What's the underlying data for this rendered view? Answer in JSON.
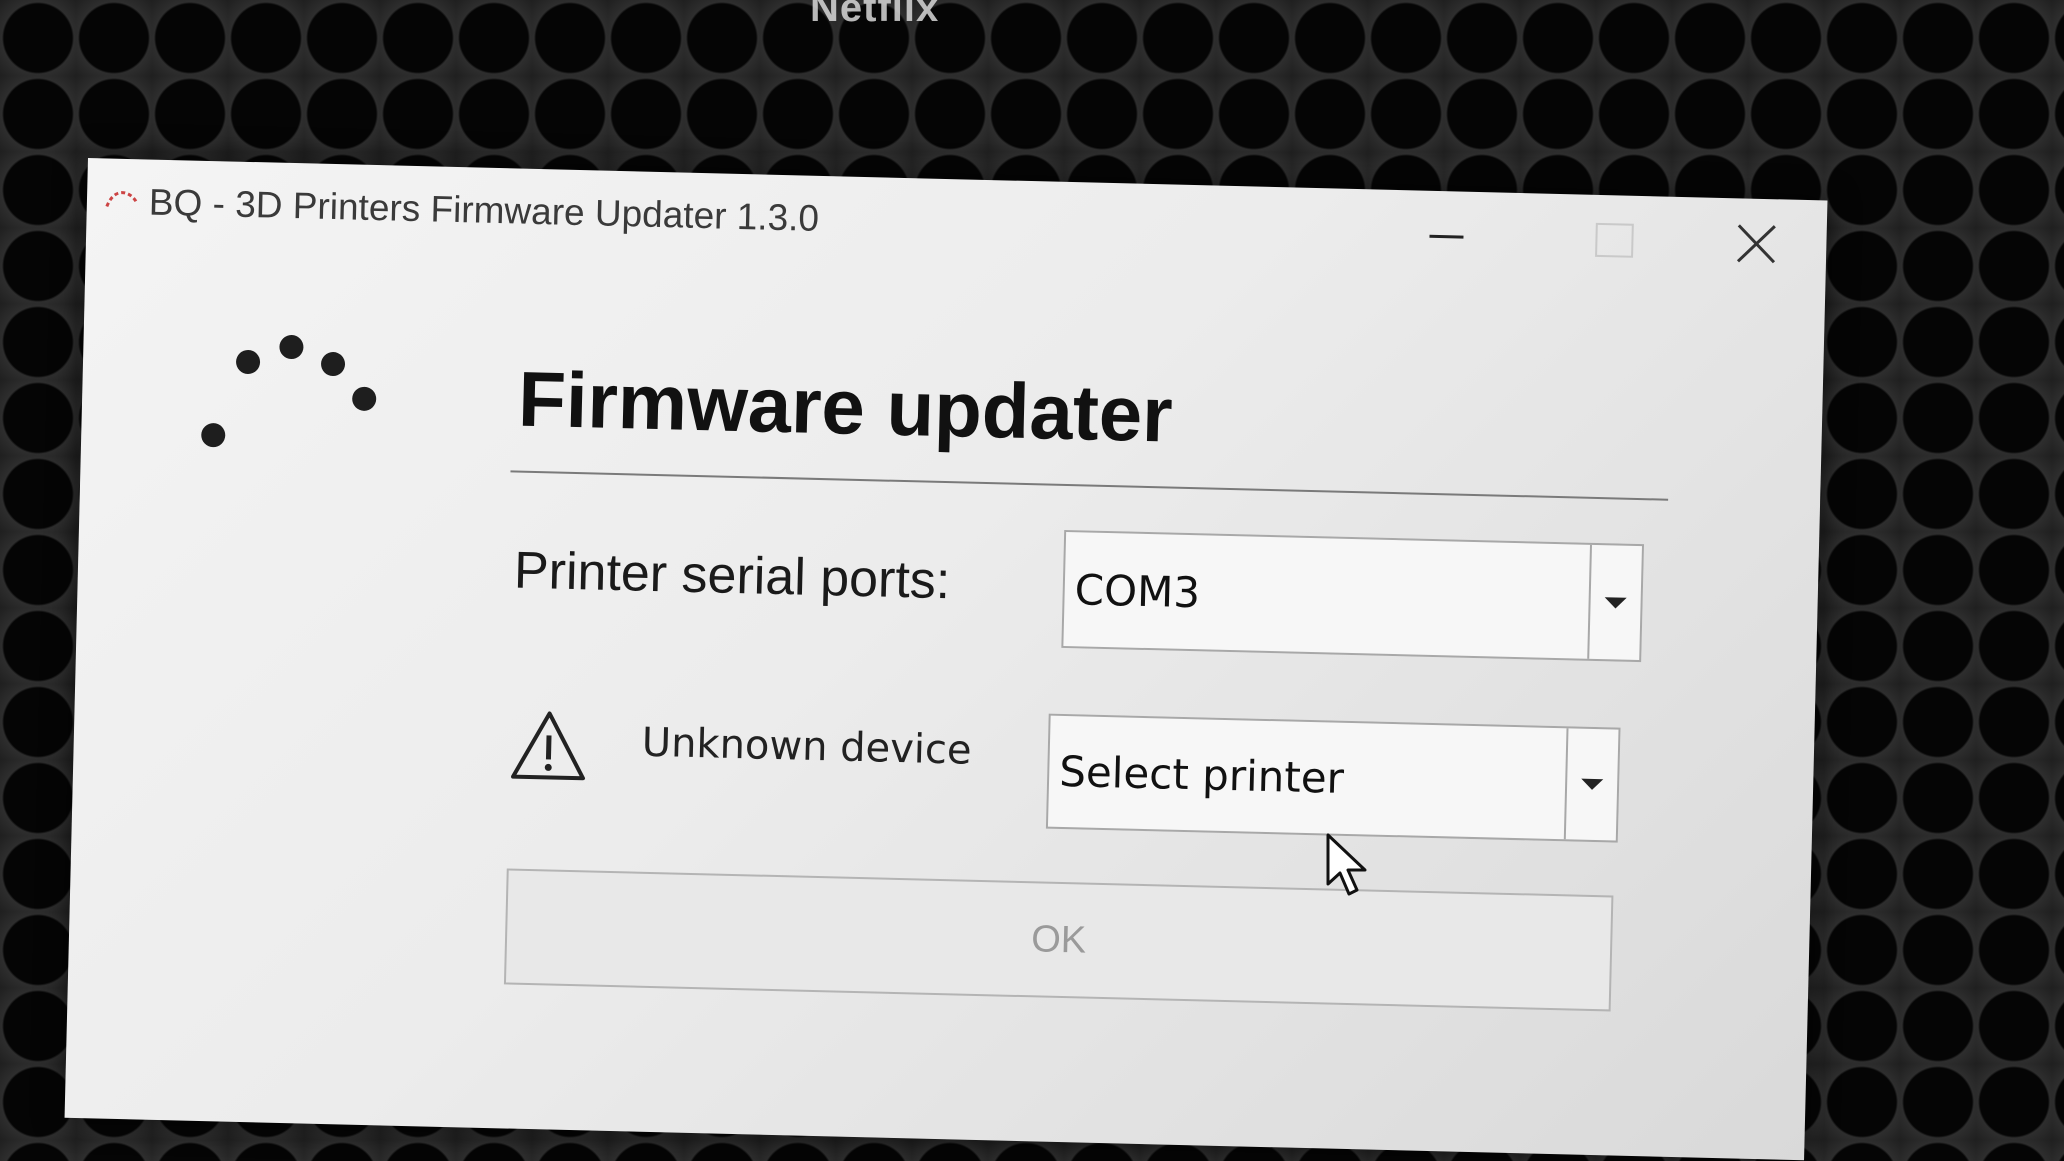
{
  "desktop": {
    "label": "Netflix"
  },
  "window": {
    "title": "BQ - 3D Printers Firmware Updater 1.3.0",
    "icon": "bq-logo-icon",
    "controls": {
      "minimize": "minimize-icon",
      "maximize": "maximize-icon",
      "close": "close-icon"
    }
  },
  "main": {
    "heading": "Firmware updater",
    "ports_label": "Printer serial ports:",
    "ports_value": "COM3",
    "device_status": "Unknown device",
    "device_status_icon": "warning-icon",
    "printer_select_value": "Select printer",
    "ok_label": "OK"
  },
  "colors": {
    "window_bg": "#f2f2f2",
    "heading": "#111111",
    "ok_text_disabled": "#9a9a9a",
    "spinner_dot": "#1e1e1e"
  }
}
